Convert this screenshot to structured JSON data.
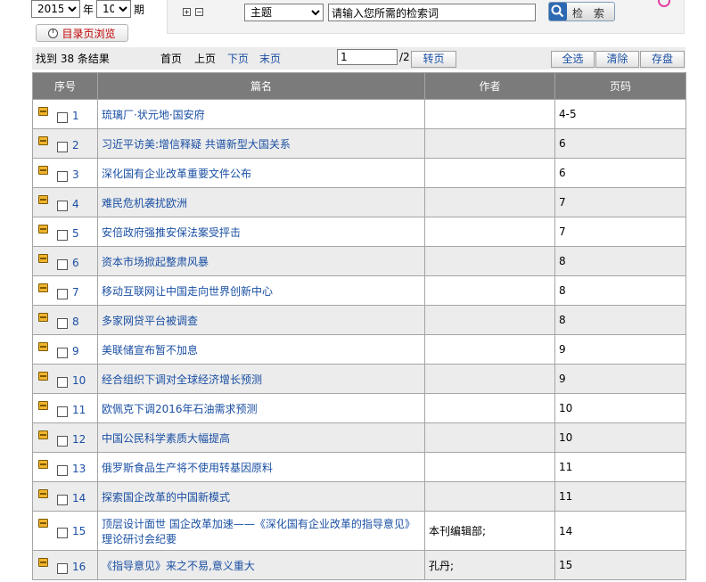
{
  "period": {
    "year": "2015",
    "year_unit": "年",
    "issue": "10",
    "issue_unit": "期"
  },
  "catalog_button": "目录页浏览",
  "search": {
    "field": "主题",
    "keyword": "请输入您所需的检索词",
    "button": "检 索"
  },
  "toolbar": {
    "result_count": "找到 38 条结果",
    "first": "首页",
    "prev": "上页",
    "next": "下页",
    "last": "末页",
    "page_value": "1",
    "page_total": "/2",
    "goto": "转页",
    "select_all": "全选",
    "clear": "清除",
    "save": "存盘"
  },
  "table": {
    "headers": [
      "序号",
      "篇名",
      "作者",
      "页码"
    ],
    "rows": [
      {
        "num": "1",
        "title": "琉璃厂·状元地·国安府",
        "author": "",
        "page": "4-5"
      },
      {
        "num": "2",
        "title": "习近平访美:增信释疑 共谱新型大国关系",
        "author": "",
        "page": "6"
      },
      {
        "num": "3",
        "title": "深化国有企业改革重要文件公布",
        "author": "",
        "page": "6"
      },
      {
        "num": "4",
        "title": "难民危机袭扰欧洲",
        "author": "",
        "page": "7"
      },
      {
        "num": "5",
        "title": "安倍政府强推安保法案受抨击",
        "author": "",
        "page": "7"
      },
      {
        "num": "6",
        "title": "资本市场掀起整肃风暴",
        "author": "",
        "page": "8"
      },
      {
        "num": "7",
        "title": "移动互联网让中国走向世界创新中心",
        "author": "",
        "page": "8"
      },
      {
        "num": "8",
        "title": "多家网贷平台被调查",
        "author": "",
        "page": "8"
      },
      {
        "num": "9",
        "title": "美联储宣布暂不加息",
        "author": "",
        "page": "9"
      },
      {
        "num": "10",
        "title": "经合组织下调对全球经济增长预测",
        "author": "",
        "page": "9"
      },
      {
        "num": "11",
        "title": "欧佩克下调2016年石油需求预测",
        "author": "",
        "page": "10"
      },
      {
        "num": "12",
        "title": "中国公民科学素质大幅提高",
        "author": "",
        "page": "10"
      },
      {
        "num": "13",
        "title": "俄罗斯食品生产将不使用转基因原料",
        "author": "",
        "page": "11"
      },
      {
        "num": "14",
        "title": "探索国企改革的中国新模式",
        "author": "",
        "page": "11"
      },
      {
        "num": "15",
        "title": "顶层设计面世 国企改革加速——《深化国有企业改革的指导意见》理论研讨会纪要",
        "author": "本刊编辑部;",
        "page": "14"
      },
      {
        "num": "16",
        "title": "《指导意见》来之不易,意义重大",
        "author": "孔丹;",
        "page": "15"
      }
    ]
  }
}
